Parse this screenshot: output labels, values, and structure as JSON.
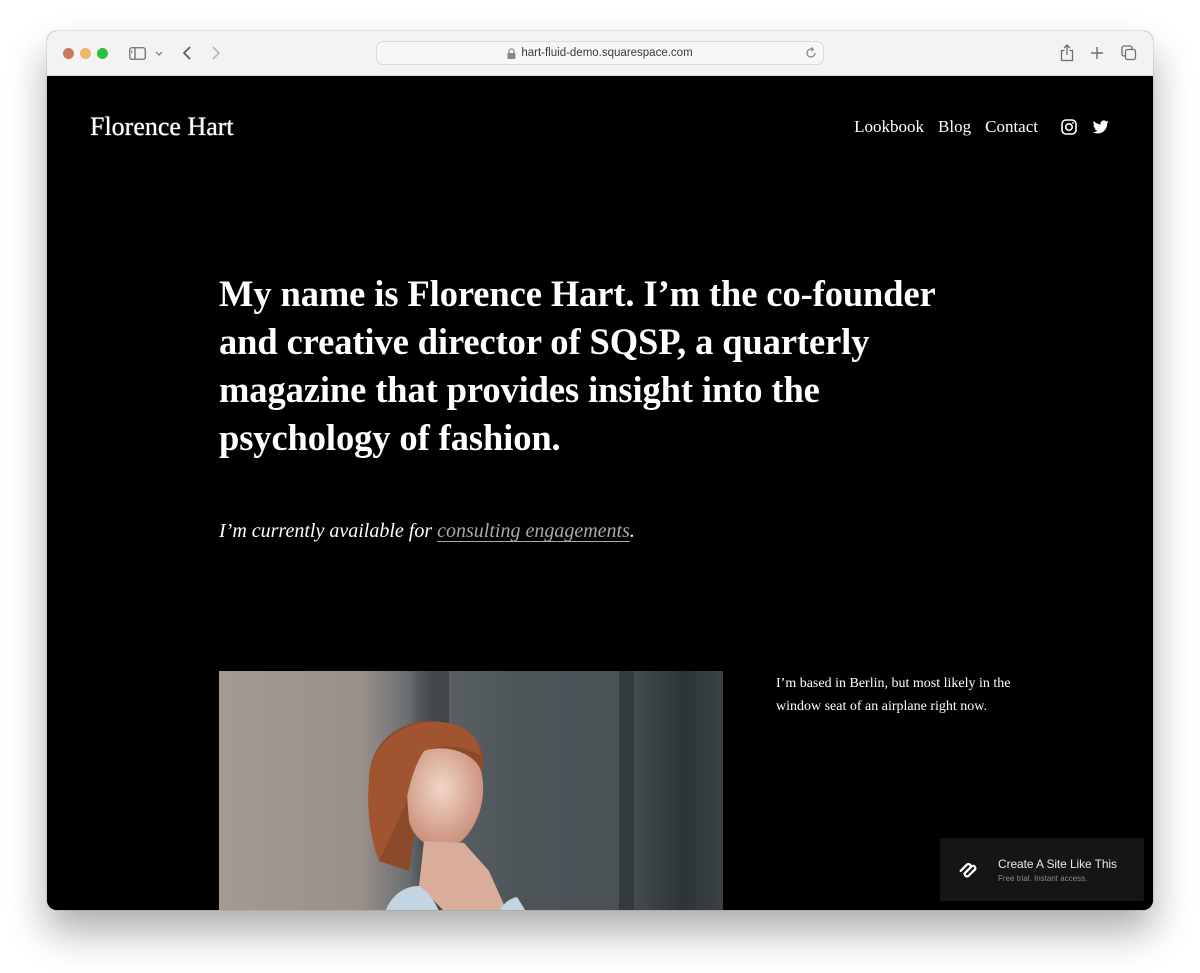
{
  "browser": {
    "url": "hart-fluid-demo.squarespace.com",
    "icons": {
      "close": "traffic-light-red",
      "minimize": "traffic-light-yellow",
      "zoom": "traffic-light-green",
      "sidebar": "sidebar-icon",
      "sidebar_menu": "chevron-down-icon",
      "back": "chevron-left-icon",
      "forward": "chevron-right-icon",
      "lock": "lock-icon",
      "reload": "reload-icon",
      "share": "share-icon",
      "new_tab": "plus-icon",
      "tab_overview": "tabs-icon"
    }
  },
  "site": {
    "title": "Florence Hart",
    "nav": [
      {
        "label": "Lookbook"
      },
      {
        "label": "Blog"
      },
      {
        "label": "Contact"
      }
    ],
    "social": [
      "instagram-icon",
      "twitter-icon"
    ]
  },
  "intro": {
    "headline": "My name is Florence Hart. I’m the co-founder and creative director of SQSP, a quarterly magazine that provides insight into the psychology of fashion.",
    "availability_prefix": "I’m currently available for ",
    "availability_link": "consulting engagements",
    "availability_suffix": "."
  },
  "about": {
    "photo_alt": "Portrait of a woman with red hair leaning against a wall in sunlight",
    "location_text": "I’m based in Berlin, but most likely in the window seat of an airplane right now."
  },
  "badge": {
    "title": "Create A Site Like This",
    "subtitle": "Free trial. Instant access."
  },
  "colors": {
    "background": "#000000",
    "text": "#ffffff",
    "link": "#a9a9a9",
    "badge_bg": "#151515"
  }
}
